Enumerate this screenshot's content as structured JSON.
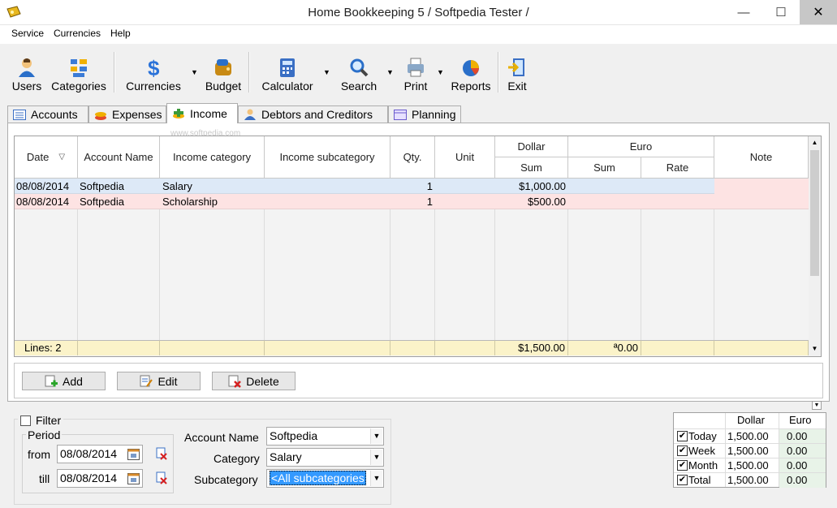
{
  "window": {
    "title": "Home Bookkeeping 5  / Softpedia Tester /",
    "minimize": "—",
    "maximize": "☐",
    "close": "✕"
  },
  "menu": [
    "Service",
    "Currencies",
    "Help"
  ],
  "toolbar": {
    "users": "Users",
    "categories": "Categories",
    "currencies": "Currencies",
    "budget": "Budget",
    "calculator": "Calculator",
    "search": "Search",
    "print": "Print",
    "reports": "Reports",
    "exit": "Exit",
    "arrow": "▼"
  },
  "tabs": [
    "Accounts",
    "Expenses",
    "Income",
    "Debtors and Creditors",
    "Planning"
  ],
  "watermark": "www.softpedia.com",
  "grid": {
    "headers": {
      "date": "Date",
      "account": "Account Name",
      "category": "Income category",
      "subcategory": "Income subcategory",
      "qty": "Qty.",
      "unit": "Unit",
      "dollar": "Dollar",
      "euro": "Euro",
      "sum": "Sum",
      "euro_sum": "Sum",
      "rate": "Rate",
      "note": "Note",
      "sort": "▽"
    },
    "rows": [
      {
        "date": "08/08/2014",
        "account": "Softpedia",
        "category": "Salary",
        "subcategory": "",
        "qty": "1",
        "unit": "",
        "dollar": "$1,000.00",
        "euro": "",
        "rate": "",
        "note": ""
      },
      {
        "date": "08/08/2014",
        "account": "Softpedia",
        "category": "Scholarship",
        "subcategory": "",
        "qty": "1",
        "unit": "",
        "dollar": "$500.00",
        "euro": "",
        "rate": "",
        "note": ""
      }
    ],
    "footer": {
      "lines": "Lines: 2",
      "dollar_total": "$1,500.00",
      "euro_total": "ª0.00"
    }
  },
  "buttons": {
    "add": "Add",
    "edit": "Edit",
    "delete": "Delete"
  },
  "filter": {
    "label": "Filter",
    "period": "Period",
    "from_label": "from",
    "till_label": "till",
    "from": "08/08/2014",
    "till": "08/08/2014",
    "account_label": "Account Name",
    "account": "Softpedia",
    "category_label": "Category",
    "category": "Salary",
    "subcategory_label": "Subcategory",
    "subcategory": "<All subcategories"
  },
  "summary": {
    "dollar": "Dollar",
    "euro": "Euro",
    "rows": [
      {
        "label": "Today",
        "dollar": "1,500.00",
        "euro": "0.00"
      },
      {
        "label": "Week",
        "dollar": "1,500.00",
        "euro": "0.00"
      },
      {
        "label": "Month",
        "dollar": "1,500.00",
        "euro": "0.00"
      },
      {
        "label": "Total",
        "dollar": "1,500.00",
        "euro": "0.00"
      }
    ]
  },
  "colors": {
    "row1": "#dde9f7",
    "row2": "#fde3e3",
    "footer": "#fbf3c9",
    "selection": "#3399ff"
  }
}
